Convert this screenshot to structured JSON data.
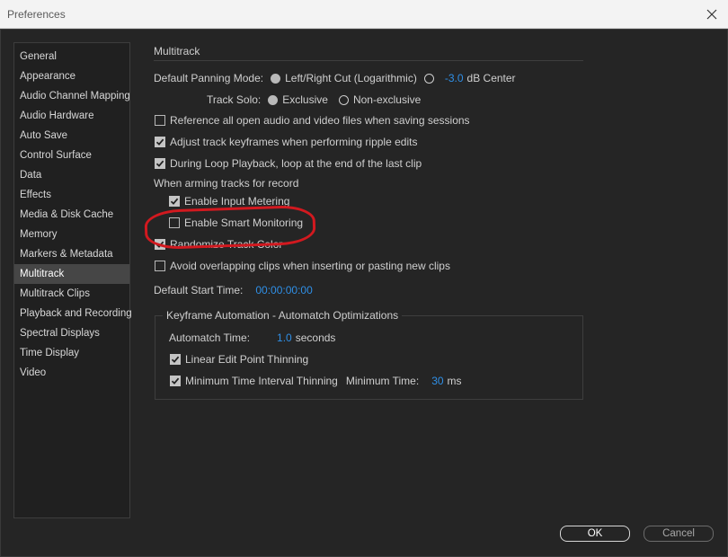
{
  "window": {
    "title": "Preferences"
  },
  "sidebar": {
    "items": [
      {
        "label": "General"
      },
      {
        "label": "Appearance"
      },
      {
        "label": "Audio Channel Mapping"
      },
      {
        "label": "Audio Hardware"
      },
      {
        "label": "Auto Save"
      },
      {
        "label": "Control Surface"
      },
      {
        "label": "Data"
      },
      {
        "label": "Effects"
      },
      {
        "label": "Media & Disk Cache"
      },
      {
        "label": "Memory"
      },
      {
        "label": "Markers & Metadata"
      },
      {
        "label": "Multitrack",
        "selected": true
      },
      {
        "label": "Multitrack Clips"
      },
      {
        "label": "Playback and Recording"
      },
      {
        "label": "Spectral Displays"
      },
      {
        "label": "Time Display"
      },
      {
        "label": "Video"
      }
    ]
  },
  "multitrack": {
    "section_title": "Multitrack",
    "panning": {
      "label": "Default Panning Mode:",
      "option1": "Left/Right Cut (Logarithmic)",
      "option2_value": "-3.0",
      "option2_suffix": "dB Center",
      "selected": "option1"
    },
    "track_solo": {
      "label": "Track Solo:",
      "option1": "Exclusive",
      "option2": "Non-exclusive",
      "selected": "option1"
    },
    "checkboxes": {
      "reference_all": {
        "label": "Reference all open audio and video files when saving sessions",
        "checked": false
      },
      "adjust_keyframes": {
        "label": "Adjust track keyframes when performing ripple edits",
        "checked": true
      },
      "loop_playback": {
        "label": "During Loop Playback, loop at the end of the last clip",
        "checked": true
      },
      "input_metering": {
        "label": "Enable Input Metering",
        "checked": true
      },
      "smart_monitoring": {
        "label": "Enable Smart Monitoring",
        "checked": false
      },
      "randomize_color": {
        "label": "Randomize Track Color",
        "checked": true
      },
      "avoid_overlap": {
        "label": "Avoid overlapping clips when inserting or pasting new clips",
        "checked": false
      }
    },
    "arming_label": "When arming tracks for record",
    "default_start": {
      "label": "Default Start Time:",
      "value": "00:00:00:00"
    }
  },
  "keyframe_group": {
    "title": "Keyframe Automation - Automatch Optimizations",
    "automatch_label": "Automatch Time:",
    "automatch_value": "1.0",
    "automatch_unit": "seconds",
    "linear_label": "Linear Edit Point Thinning",
    "linear_checked": true,
    "min_interval_label": "Minimum Time Interval Thinning",
    "min_interval_checked": true,
    "min_time_label": "Minimum Time:",
    "min_time_value": "30",
    "min_time_unit": "ms"
  },
  "buttons": {
    "ok": "OK",
    "cancel": "Cancel"
  },
  "colors": {
    "accent": "#2f8fe6",
    "annotation": "#d2191f"
  }
}
